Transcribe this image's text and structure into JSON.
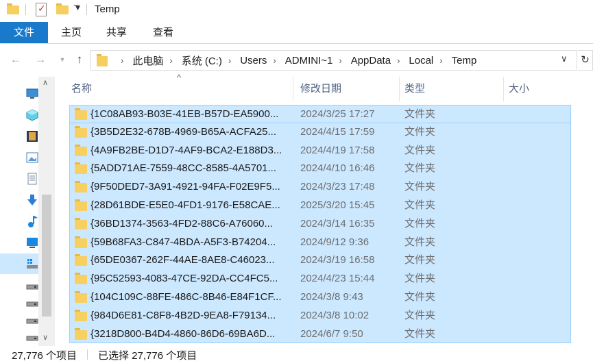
{
  "window": {
    "title": "Temp"
  },
  "ribbon": {
    "tabs": [
      {
        "label": "文件"
      },
      {
        "label": "主页"
      },
      {
        "label": "共享"
      },
      {
        "label": "查看"
      }
    ]
  },
  "address": {
    "crumbs": [
      "此电脑",
      "系统 (C:)",
      "Users",
      "ADMINI~1",
      "AppData",
      "Local",
      "Temp"
    ]
  },
  "columns": {
    "name": "名称",
    "date": "修改日期",
    "type": "类型",
    "size": "大小"
  },
  "files": [
    {
      "name": "{1C08AB93-B03E-41EB-B57D-EA5900...",
      "date": "2024/3/25 17:27",
      "type": "文件夹"
    },
    {
      "name": "{3B5D2E32-678B-4969-B65A-ACFA25...",
      "date": "2024/4/15 17:59",
      "type": "文件夹"
    },
    {
      "name": "{4A9FB2BE-D1D7-4AF9-BCA2-E188D3...",
      "date": "2024/4/19 17:58",
      "type": "文件夹"
    },
    {
      "name": "{5ADD71AE-7559-48CC-8585-4A5701...",
      "date": "2024/4/10 16:46",
      "type": "文件夹"
    },
    {
      "name": "{9F50DED7-3A91-4921-94FA-F02E9F5...",
      "date": "2024/3/23 17:48",
      "type": "文件夹"
    },
    {
      "name": "{28D61BDE-E5E0-4FD1-9176-E58CAE...",
      "date": "2025/3/20 15:45",
      "type": "文件夹"
    },
    {
      "name": "{36BD1374-3563-4FD2-88C6-A76060...",
      "date": "2024/3/14 16:35",
      "type": "文件夹"
    },
    {
      "name": "{59B68FA3-C847-4BDA-A5F3-B74204...",
      "date": "2024/9/12 9:36",
      "type": "文件夹"
    },
    {
      "name": "{65DE0367-262F-44AE-8AE8-C46023...",
      "date": "2024/3/19 16:58",
      "type": "文件夹"
    },
    {
      "name": "{95C52593-4083-47CE-92DA-CC4FC5...",
      "date": "2024/4/23 15:44",
      "type": "文件夹"
    },
    {
      "name": "{104C109C-88FE-486C-8B46-E84F1CF...",
      "date": "2024/3/8 9:43",
      "type": "文件夹"
    },
    {
      "name": "{984D6E81-C8F8-4B2D-9EA8-F79134...",
      "date": "2024/3/8 10:02",
      "type": "文件夹"
    },
    {
      "name": "{3218D800-B4D4-4860-86D6-69BA6D...",
      "date": "2024/6/7 9:50",
      "type": "文件夹"
    }
  ],
  "status": {
    "count": "27,776 个项目",
    "selected": "已选择 27,776 个项目"
  },
  "colors": {
    "accent": "#1979ca",
    "selection": "#cce8ff",
    "selection_border": "#99d1ff",
    "folder": "#f8d062"
  },
  "icons": {
    "nav": [
      "this-pc-icon",
      "3d-objects-icon",
      "videos-icon",
      "pictures-icon",
      "documents-icon",
      "downloads-icon",
      "music-icon",
      "desktop-icon",
      "system-drive-icon",
      "drive-icon",
      "drive-icon",
      "drive-icon",
      "drive-icon"
    ]
  }
}
